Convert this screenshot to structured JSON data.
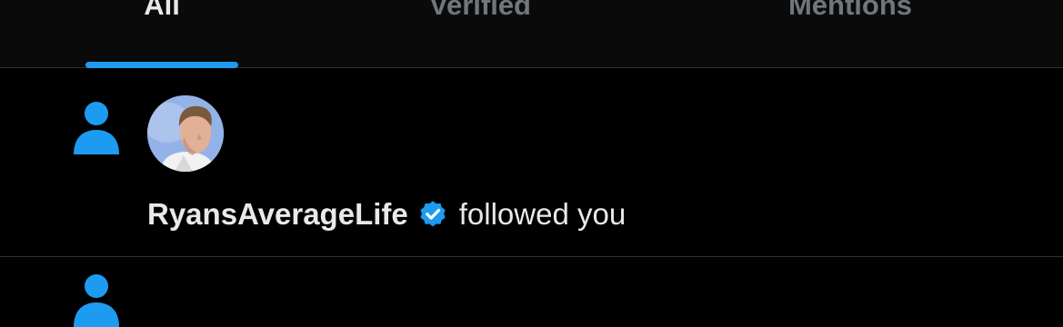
{
  "tabs": [
    {
      "label": "All",
      "active": true
    },
    {
      "label": "Verified",
      "active": false
    },
    {
      "label": "Mentions",
      "active": false
    }
  ],
  "notification": {
    "icon": "person-icon",
    "user_name": "RyansAverageLife",
    "verified": true,
    "action": "followed you"
  },
  "colors": {
    "accent": "#1d9bf0",
    "background": "#000000",
    "text_primary": "#e7e9ea",
    "text_secondary": "#71767b",
    "divider": "#2f3336"
  }
}
